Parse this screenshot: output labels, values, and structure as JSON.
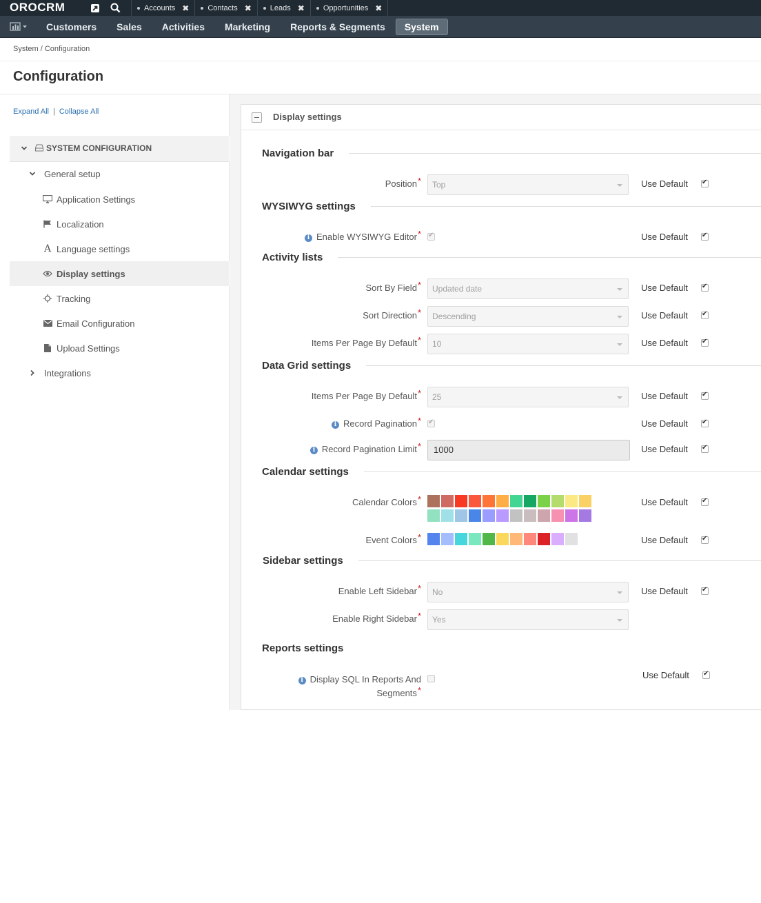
{
  "app": {
    "logo": "OROCRM"
  },
  "pinned_tabs": [
    "Accounts",
    "Contacts",
    "Leads",
    "Opportunities"
  ],
  "nav": {
    "items": [
      "Customers",
      "Sales",
      "Activities",
      "Marketing",
      "Reports & Segments",
      "System"
    ],
    "active": "System"
  },
  "breadcrumb": "System / Configuration",
  "page_title": "Configuration",
  "sidebar": {
    "expand_all": "Expand All",
    "separator": "|",
    "collapse_all": "Collapse All",
    "root": "SYSTEM CONFIGURATION",
    "general_setup": "General setup",
    "items": [
      "Application Settings",
      "Localization",
      "Language settings",
      "Display settings",
      "Tracking",
      "Email Configuration",
      "Upload Settings"
    ],
    "selected": "Display settings",
    "integrations": "Integrations"
  },
  "panel": {
    "title": "Display settings"
  },
  "sections": {
    "navigation_bar": "Navigation bar",
    "wysiwyg": "WYSIWYG settings",
    "activity_lists": "Activity lists",
    "data_grid": "Data Grid settings",
    "calendar": "Calendar settings",
    "sidebar": "Sidebar settings",
    "reports": "Reports settings"
  },
  "fields": {
    "position": {
      "label": "Position",
      "value": "Top"
    },
    "enable_wysiwyg": {
      "label": "Enable WYSIWYG Editor",
      "checked": true
    },
    "sort_by_field": {
      "label": "Sort By Field",
      "value": "Updated date"
    },
    "sort_direction": {
      "label": "Sort Direction",
      "value": "Descending"
    },
    "activity_items_per_page": {
      "label": "Items Per Page By Default",
      "value": "10"
    },
    "grid_items_per_page": {
      "label": "Items Per Page By Default",
      "value": "25"
    },
    "record_pagination": {
      "label": "Record Pagination",
      "checked": true
    },
    "record_pagination_limit": {
      "label": "Record Pagination Limit",
      "value": "1000"
    },
    "calendar_colors": {
      "label": "Calendar Colors"
    },
    "event_colors": {
      "label": "Event Colors"
    },
    "enable_left_sidebar": {
      "label": "Enable Left Sidebar",
      "value": "No"
    },
    "enable_right_sidebar": {
      "label": "Enable Right Sidebar",
      "value": "Yes"
    },
    "display_sql": {
      "label_line1": "Display SQL In Reports And",
      "label_line2": "Segments",
      "checked": false
    }
  },
  "required_mark": "*",
  "use_default_label": "Use Default",
  "calendar_colors": [
    "#ac725e",
    "#d06b64",
    "#f83a22",
    "#fa573c",
    "#ff7537",
    "#ffad46",
    "#42d692",
    "#16a765",
    "#7bd148",
    "#b3dc6c",
    "#fbe983",
    "#fad165",
    "#92e1c0",
    "#9fe1e7",
    "#9fc6e7",
    "#4986e7",
    "#9a9cff",
    "#b99aff",
    "#c2c2c2",
    "#cabdbf",
    "#cca6ac",
    "#f691b2",
    "#cd74e6",
    "#a47ae2"
  ],
  "event_colors": [
    "#5484ed",
    "#a4bdfc",
    "#46d6db",
    "#7ae7bf",
    "#51b749",
    "#fbd75b",
    "#ffb878",
    "#ff887c",
    "#dc2127",
    "#dbadff",
    "#e1e1e1"
  ]
}
